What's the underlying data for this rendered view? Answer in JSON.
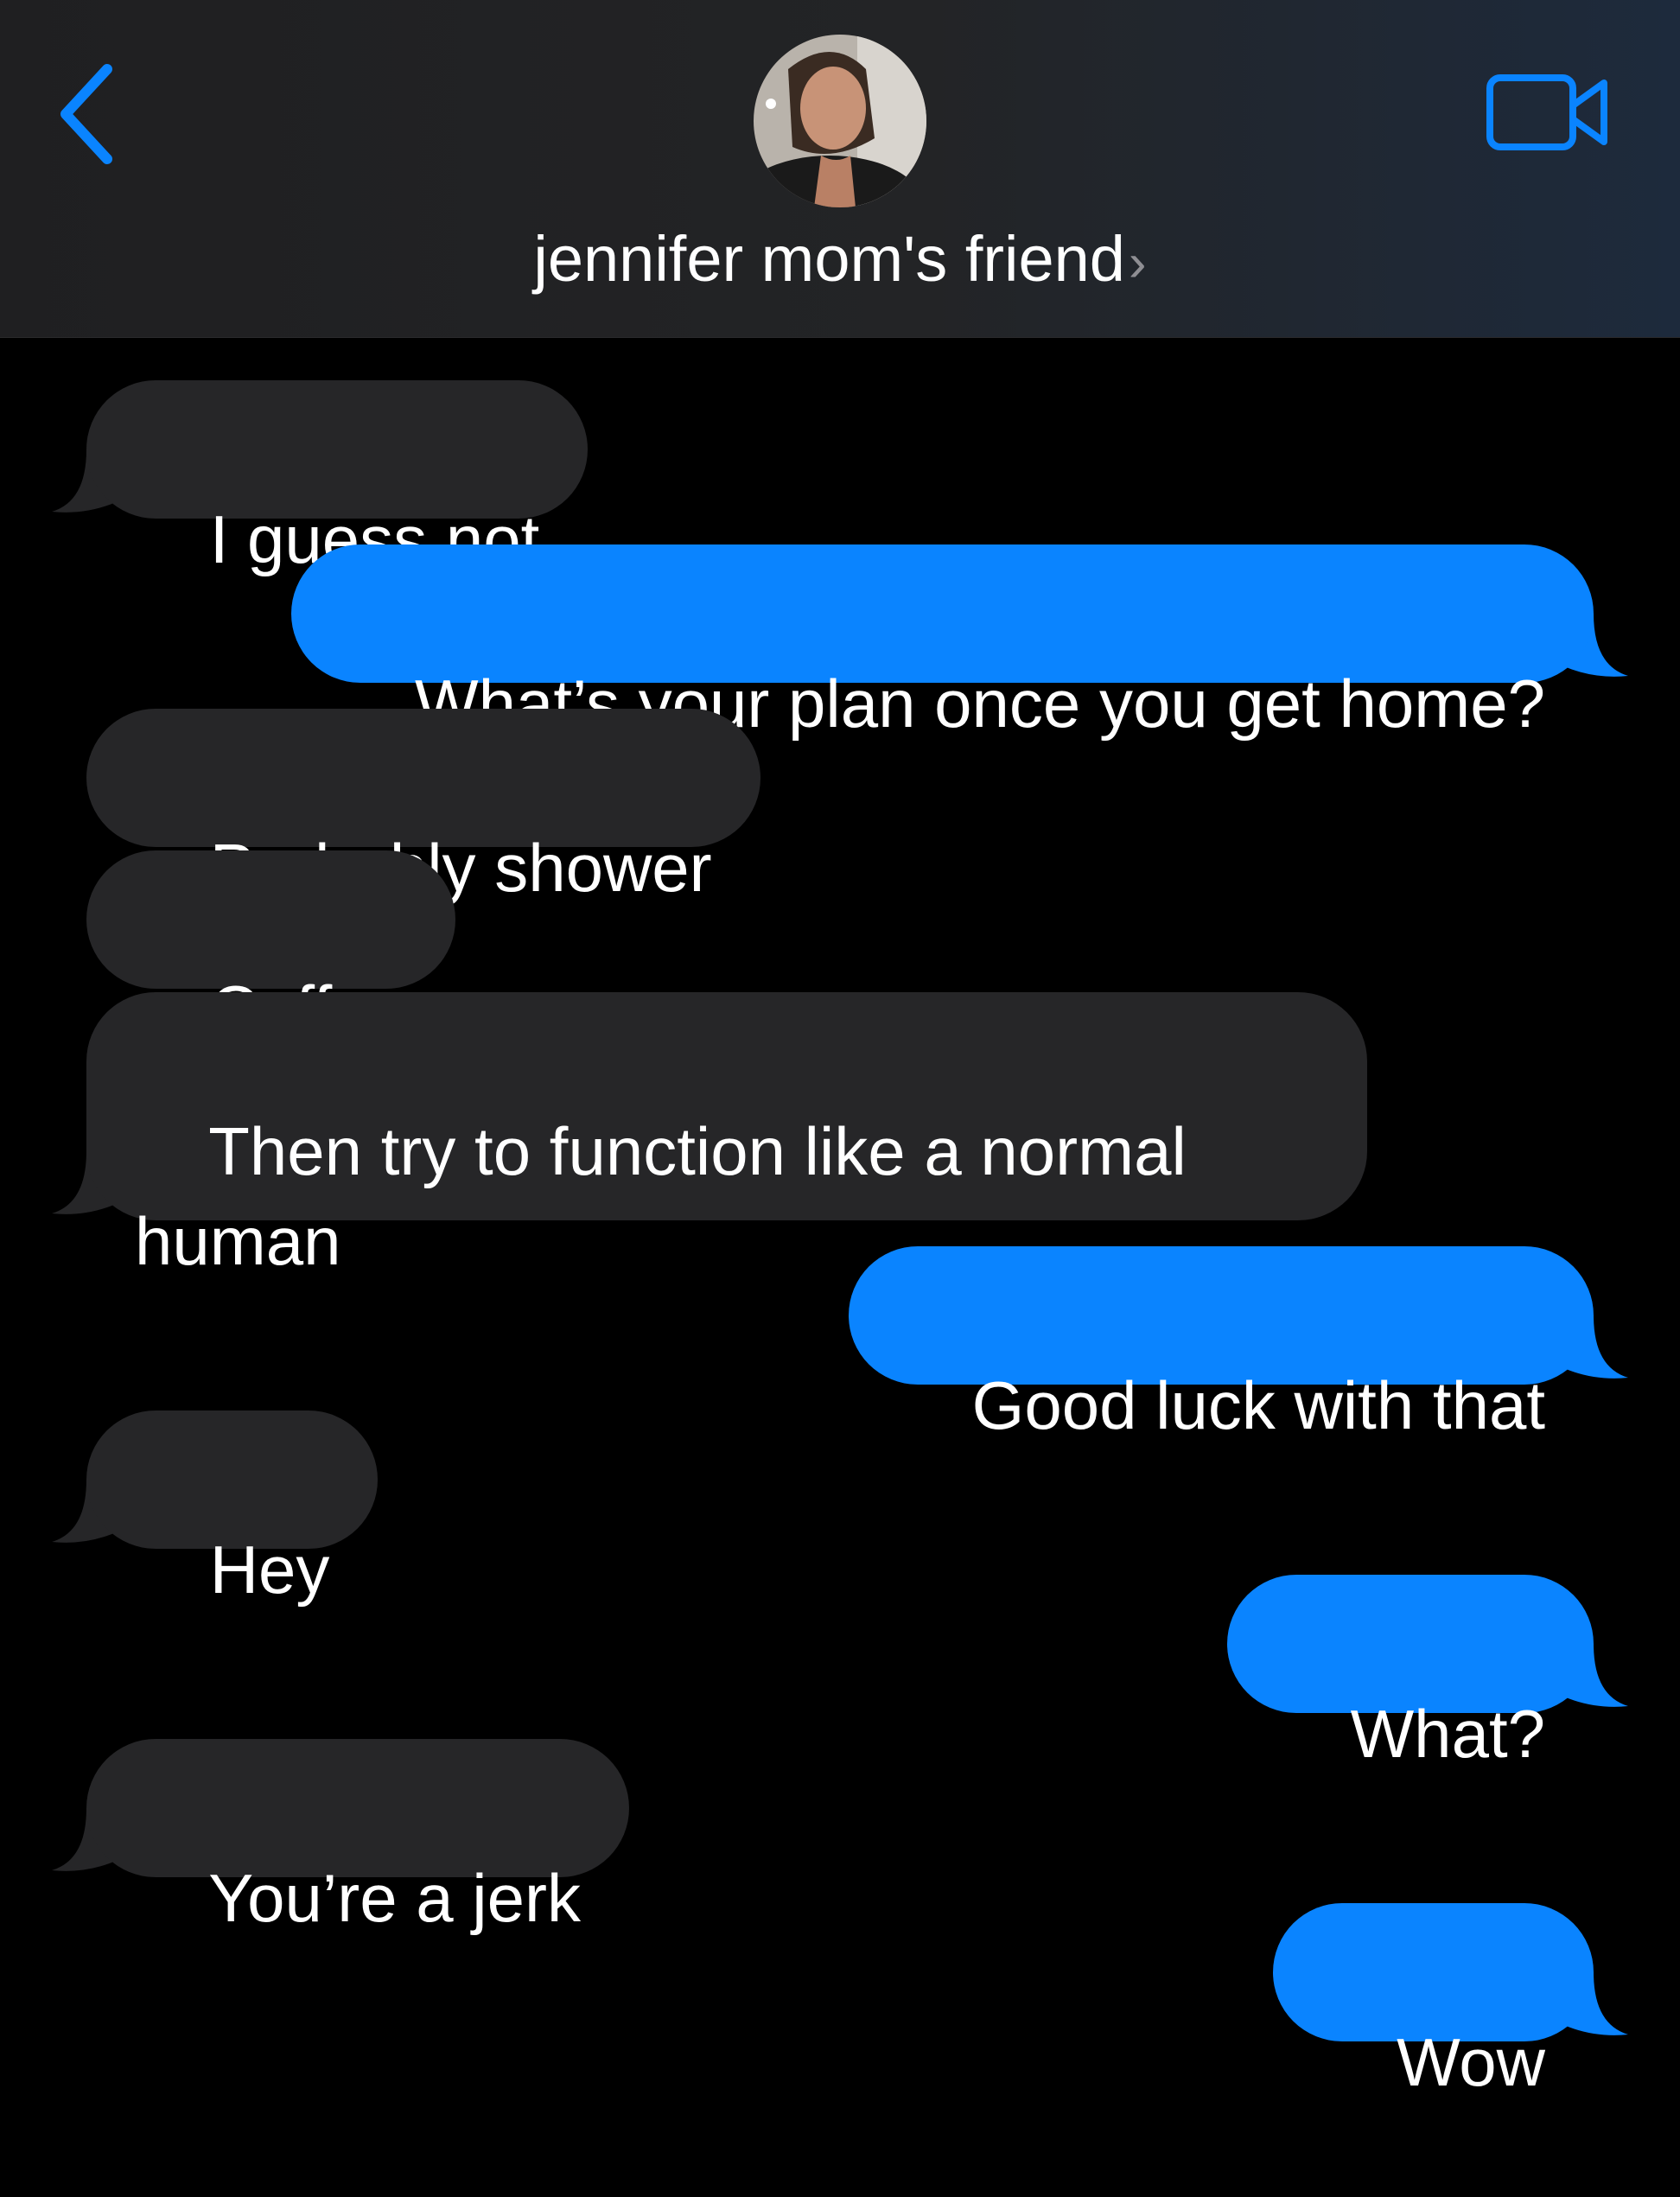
{
  "header": {
    "contact_name": "jennifer mom's friend",
    "name_chevron": "›",
    "back_icon": "chevron-left-icon",
    "video_icon": "video-camera-icon",
    "accent": "#0a84ff"
  },
  "messages": [
    {
      "from": "them",
      "text": "I guess not"
    },
    {
      "from": "me",
      "text": "What’s your plan once you get home?"
    },
    {
      "from": "them",
      "text": "Probably shower"
    },
    {
      "from": "them",
      "text": "Coffee"
    },
    {
      "from": "them",
      "text": "Then try to function like a normal\nhuman"
    },
    {
      "from": "me",
      "text": "Good luck with that"
    },
    {
      "from": "them",
      "text": "Hey"
    },
    {
      "from": "me",
      "text": "What?"
    },
    {
      "from": "them",
      "text": "You’re a jerk"
    },
    {
      "from": "me",
      "text": "Wow"
    }
  ],
  "colors": {
    "received_bubble": "#262628",
    "sent_bubble": "#0a84ff",
    "background": "#000000"
  }
}
